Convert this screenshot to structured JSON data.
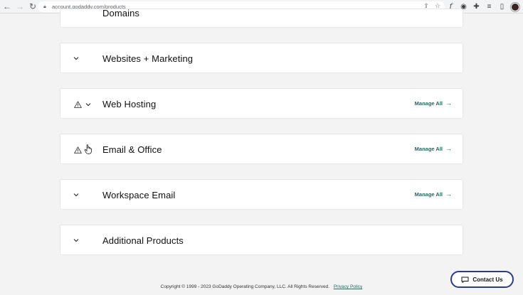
{
  "browser": {
    "url": "account.godaddy.com/products"
  },
  "sections": [
    {
      "title": "Domains",
      "has_warning": false,
      "manage_label": ""
    },
    {
      "title": "Websites + Marketing",
      "has_warning": false,
      "manage_label": ""
    },
    {
      "title": "Web Hosting",
      "has_warning": true,
      "manage_label": "Manage All"
    },
    {
      "title": "Email & Office",
      "has_warning": true,
      "manage_label": "Manage All"
    },
    {
      "title": "Workspace Email",
      "has_warning": false,
      "manage_label": "Manage All"
    },
    {
      "title": "Additional Products",
      "has_warning": false,
      "manage_label": ""
    }
  ],
  "footer": {
    "copyright": "Copyright © 1999 - 2023 GoDaddy Operating Company, LLC. All Rights Reserved.",
    "privacy_link": "Privacy Policy"
  },
  "contact": {
    "label": "Contact Us"
  },
  "icons": {
    "chevron": "chevron-down-icon",
    "warning": "warning-icon",
    "arrow": "arrow-right-icon",
    "chat": "chat-icon"
  },
  "colors": {
    "accent": "#1a6b61",
    "contact_border": "#2b3a8e"
  }
}
